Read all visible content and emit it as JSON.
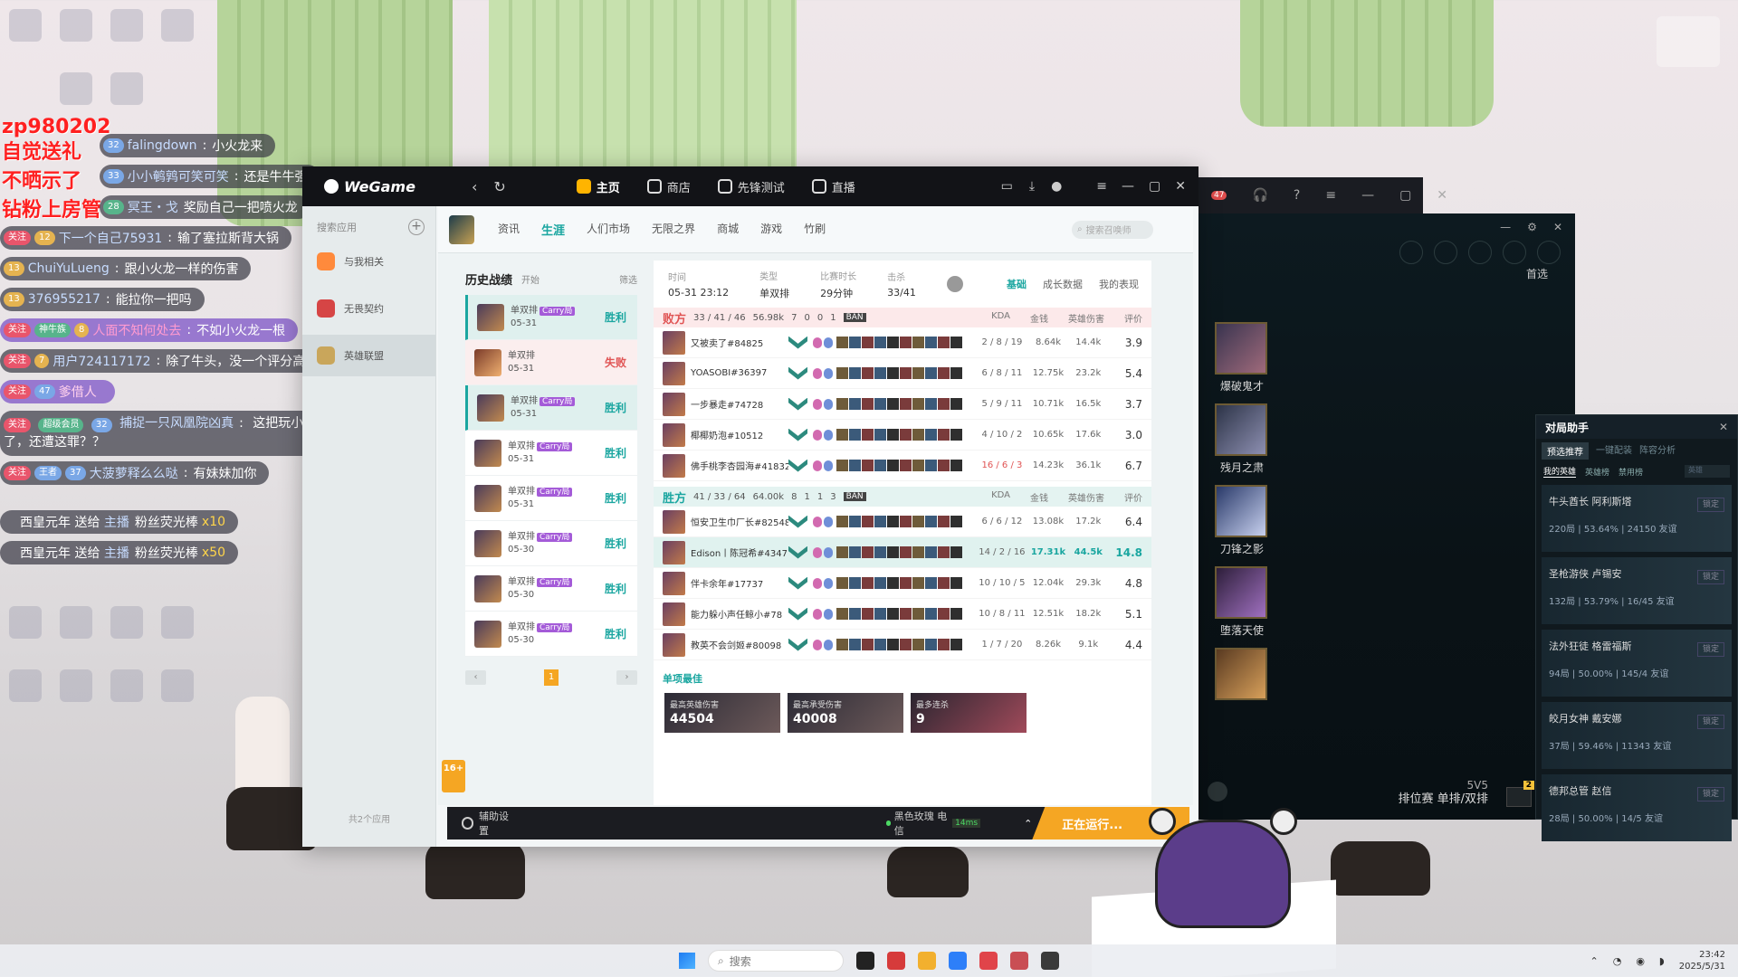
{
  "danmaku": {
    "red_names": [
      "zp980202",
      "自觉送礼",
      "不晒示了",
      "钻粉上房管"
    ],
    "messages": [
      {
        "tags": [
          "32"
        ],
        "name": "falingdown",
        "text": "小火龙来"
      },
      {
        "tags": [
          "33"
        ],
        "name": "小小鹌鹑可笑可笑",
        "text": "还是牛牛强"
      },
      {
        "tags": [
          "28"
        ],
        "name": "冥王・戈",
        "text": "奖励自己一把喷火龙"
      },
      {
        "tags": [
          "关注",
          "12"
        ],
        "name": "下一个自己75931",
        "text": "输了塞拉斯背大锅"
      },
      {
        "tags": [
          "13"
        ],
        "name": "ChuiYuLueng",
        "text": "跟小火龙一样的伤害"
      },
      {
        "tags": [
          "13"
        ],
        "name": "376955217",
        "text": "能拉你一把吗"
      },
      {
        "tags": [
          "关注",
          "神牛族",
          "8"
        ],
        "name": "人面不知何处去",
        "text": "不如小火龙一根"
      },
      {
        "tags": [
          "关注",
          "7"
        ],
        "name": "用户724117172",
        "text": "除了牛头，没一个评分高于7"
      },
      {
        "tags": [
          "关注",
          "47"
        ],
        "name": "爹借人",
        "text": ""
      },
      {
        "tags": [
          "关注",
          "超级会员",
          "32"
        ],
        "name": "捕捉一只风凰院凶真",
        "text": "这把玩小火龙早结束了，还遭这罪？？"
      },
      {
        "tags": [
          "关注",
          "王者",
          "37"
        ],
        "name": "大菠萝释么么哒",
        "text": "有妹妹加你"
      }
    ],
    "gifts": [
      {
        "user": "西皇元年",
        "verb": "送给",
        "target": "主播",
        "gift": "粉丝荧光棒",
        "count": "x10"
      },
      {
        "user": "西皇元年",
        "verb": "送给",
        "target": "主播",
        "gift": "粉丝荧光棒",
        "count": "x50"
      }
    ]
  },
  "wegame": {
    "brand": "WeGame",
    "tabs": [
      {
        "label": "主页"
      },
      {
        "label": "商店"
      },
      {
        "label": "先锋测试"
      },
      {
        "label": "直播"
      }
    ],
    "sidebar": {
      "head": "搜索应用",
      "items": [
        {
          "label": "与我相关"
        },
        {
          "label": "无畏契约"
        },
        {
          "label": "英雄联盟"
        }
      ],
      "footer": "共2个应用"
    },
    "age_badge": "16+"
  },
  "lol": {
    "menu": [
      {
        "label": "资讯"
      },
      {
        "label": "生涯"
      },
      {
        "label": "人们市场"
      },
      {
        "label": "无限之界"
      },
      {
        "label": "商城"
      },
      {
        "label": "游戏"
      },
      {
        "label": "竹刷"
      }
    ],
    "search_placeholder": "搜索召唤师",
    "history": {
      "title": "历史战绩",
      "subtitle": "开始",
      "filter": "筛选",
      "rows": [
        {
          "mode": "单双排",
          "carry": "Carry局",
          "date": "05-31",
          "result": "胜利"
        },
        {
          "mode": "单双排",
          "carry": "",
          "date": "05-31",
          "result": "失败"
        },
        {
          "mode": "单双排",
          "carry": "Carry局",
          "date": "05-31",
          "result": "胜利"
        },
        {
          "mode": "单双排",
          "carry": "Carry局",
          "date": "05-31",
          "result": "胜利"
        },
        {
          "mode": "单双排",
          "carry": "Carry局",
          "date": "05-31",
          "result": "胜利"
        },
        {
          "mode": "单双排",
          "carry": "Carry局",
          "date": "05-30",
          "result": "胜利"
        },
        {
          "mode": "单双排",
          "carry": "Carry局",
          "date": "05-30",
          "result": "胜利"
        },
        {
          "mode": "单双排",
          "carry": "Carry局",
          "date": "05-30",
          "result": "胜利"
        }
      ],
      "page": "1"
    },
    "detail": {
      "time_label": "时间",
      "time": "05-31 23:12",
      "mode_label": "类型",
      "mode": "单双排",
      "duration_label": "比赛时长",
      "duration": "29分钟",
      "score_label": "击杀",
      "score": "33/41",
      "tabs": [
        {
          "label": "基础"
        },
        {
          "label": "成长数据"
        },
        {
          "label": "我的表现"
        }
      ],
      "cols": {
        "kda": "KDA",
        "gold": "金钱",
        "dmg": "英雄伤害",
        "score": "评价"
      },
      "ban": "BAN",
      "losing_team": {
        "side": "败方",
        "kills": "33 / 41 / 46",
        "gold": "56.98k",
        "towers": "7",
        "dragons": "0",
        "barons": "0",
        "heralds": "1",
        "players": [
          {
            "name": "又被卖了#84825",
            "kda": "2 / 8 / 19",
            "gold": "8.64k",
            "dmg": "14.4k",
            "score": "3.9"
          },
          {
            "name": "YOASOBI#36397",
            "kda": "6 / 8 / 11",
            "gold": "12.75k",
            "dmg": "23.2k",
            "score": "5.4"
          },
          {
            "name": "一步暴走#74728",
            "kda": "5 / 9 / 11",
            "gold": "10.71k",
            "dmg": "16.5k",
            "score": "3.7"
          },
          {
            "name": "椰椰奶泡#10512",
            "kda": "4 / 10 / 2",
            "gold": "10.65k",
            "dmg": "17.6k",
            "score": "3.0"
          },
          {
            "name": "佛手桃李杏园海#41832",
            "kda": "16 / 6 / 3",
            "gold": "14.23k",
            "dmg": "36.1k",
            "score": "6.7"
          }
        ]
      },
      "winning_team": {
        "side": "胜方",
        "kills": "41 / 33 / 64",
        "gold": "64.00k",
        "towers": "8",
        "dragons": "1",
        "barons": "1",
        "heralds": "3",
        "players": [
          {
            "name": "恒安卫生巾厂长#82548",
            "kda": "6 / 6 / 12",
            "gold": "13.08k",
            "dmg": "17.2k",
            "score": "6.4"
          },
          {
            "name": "Edison丨陈冠希#43471",
            "kda": "14 / 2 / 16",
            "gold": "17.31k",
            "dmg": "44.5k",
            "score": "14.8"
          },
          {
            "name": "伴卡余年#17737",
            "kda": "10 / 10 / 5",
            "gold": "12.04k",
            "dmg": "29.3k",
            "score": "4.8"
          },
          {
            "name": "能力躲小声任鲸小#78",
            "kda": "10 / 8 / 11",
            "gold": "12.51k",
            "dmg": "18.2k",
            "score": "5.1"
          },
          {
            "name": "教英不会剑姬#80098",
            "kda": "1 / 7 / 20",
            "gold": "8.26k",
            "dmg": "9.1k",
            "score": "4.4"
          }
        ]
      },
      "best_title": "单项最佳",
      "best": [
        {
          "label": "最高英雄伤害",
          "value": "44504"
        },
        {
          "label": "最高承受伤害",
          "value": "40008"
        },
        {
          "label": "最多连杀",
          "value": "9"
        }
      ]
    },
    "bottom": {
      "assist": "辅助设置",
      "server": "黑色玫瑰 电信",
      "ping": "14ms",
      "running": "正在运行..."
    }
  },
  "client": {
    "bar_badge": "47",
    "first_pick": "首选",
    "champions": [
      {
        "name": "爆破鬼才"
      },
      {
        "name": "残月之肃"
      },
      {
        "name": "刀锋之影"
      },
      {
        "name": "堕落天使"
      },
      {
        "name": ""
      }
    ],
    "mode_line1": "5V5",
    "mode_line2": "排位赛 单排/双排",
    "badges": [
      "2",
      "2"
    ]
  },
  "assistant": {
    "title": "对局助手",
    "tabs": [
      {
        "label": "预选推荐"
      },
      {
        "label": "一键配装"
      },
      {
        "label": "阵容分析"
      }
    ],
    "sub_tabs": [
      {
        "label": "我的英雄"
      },
      {
        "label": "英雄榜"
      },
      {
        "label": "禁用榜"
      }
    ],
    "search": "英雄",
    "cards": [
      {
        "name": "牛头酋长 阿利斯塔",
        "stats": "220局 | 53.64% | 24150",
        "tag": "友谊",
        "btn": "锁定"
      },
      {
        "name": "圣枪游侠 卢锡安",
        "stats": "132局 | 53.79% | 16/45",
        "tag": "友谊",
        "btn": "锁定"
      },
      {
        "name": "法外狂徒 格雷福斯",
        "stats": "94局 | 50.00% | 145/4",
        "tag": "友谊",
        "btn": "锁定"
      },
      {
        "name": "皎月女神 戴安娜",
        "stats": "37局 | 59.46% | 11343",
        "tag": "友谊",
        "btn": "锁定"
      },
      {
        "name": "德邦总管 赵信",
        "stats": "28局 | 50.00% | 14/5",
        "tag": "友谊",
        "btn": "锁定"
      }
    ]
  },
  "taskbar": {
    "search": "搜索",
    "time": "23:42",
    "date": "2025/5/31"
  }
}
